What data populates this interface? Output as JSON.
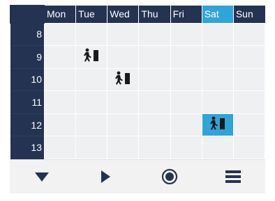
{
  "schedule": {
    "days": [
      {
        "label": "Mon",
        "selected": false
      },
      {
        "label": "Tue",
        "selected": false
      },
      {
        "label": "Wed",
        "selected": false
      },
      {
        "label": "Thu",
        "selected": false
      },
      {
        "label": "Fri",
        "selected": false
      },
      {
        "label": "Sat",
        "selected": true
      },
      {
        "label": "Sun",
        "selected": false
      }
    ],
    "hours": [
      "8",
      "9",
      "10",
      "11",
      "12",
      "13"
    ],
    "events": [
      {
        "day": "Tue",
        "hour": "9",
        "icon": "person-leaving-icon"
      },
      {
        "day": "Wed",
        "hour": "10",
        "icon": "person-leaving-icon"
      },
      {
        "day": "Sat",
        "hour": "12",
        "icon": "person-leaving-icon",
        "highlighted": true
      }
    ]
  },
  "toolbar": {
    "buttons": [
      {
        "name": "dropdown-button",
        "icon": "triangle-down-icon"
      },
      {
        "name": "play-button",
        "icon": "play-icon"
      },
      {
        "name": "record-button",
        "icon": "record-icon"
      },
      {
        "name": "menu-button",
        "icon": "hamburger-menu-icon"
      }
    ]
  },
  "colors": {
    "header_bg": "#243352",
    "selected": "#2fa4d8",
    "slot_bg": "#eef0f2",
    "icon": "#1a1a1a"
  }
}
